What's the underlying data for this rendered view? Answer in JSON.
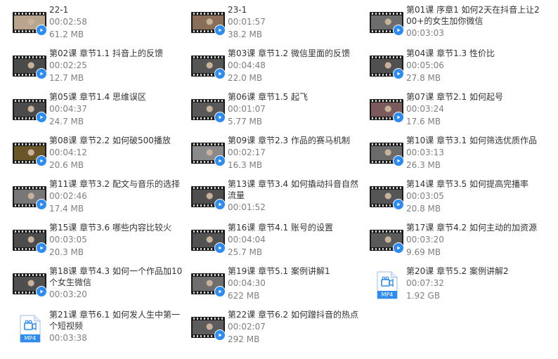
{
  "files": [
    {
      "name": "22-1",
      "duration": "00:02:58",
      "size": "61.2 MB",
      "type": "video",
      "frame": "#b9a58e"
    },
    {
      "name": "23-1",
      "duration": "00:01:57",
      "size": "38.2 MB",
      "type": "video",
      "frame": "#8a6e57"
    },
    {
      "name": "第01课 序章1 如何2天在抖音上让200+的女生加你微信",
      "duration": "00:03:03",
      "size": "",
      "type": "video",
      "frame": "#6d6d6d"
    },
    {
      "name": "第02课 章节1.1 抖音上的反馈",
      "duration": "00:02:25",
      "size": "12.7 MB",
      "type": "video",
      "frame": "#4a4a4a"
    },
    {
      "name": "第03课 章节1.2 微信里面的反馈",
      "duration": "00:04:48",
      "size": "22.0 MB",
      "type": "video",
      "frame": "#555555"
    },
    {
      "name": "第04课 章节1.3 性价比",
      "duration": "00:05:06",
      "size": "27.8 MB",
      "type": "video",
      "frame": "#505050"
    },
    {
      "name": "第05课 章节1.4 思维误区",
      "duration": "00:04:37",
      "size": "24.7 MB",
      "type": "video",
      "frame": "#4b4b4b"
    },
    {
      "name": "第06课 章节1.5 起飞",
      "duration": "00:01:07",
      "size": "5.77 MB",
      "type": "video",
      "frame": "#585858"
    },
    {
      "name": "第07课 章节2.1 如何起号",
      "duration": "00:03:24",
      "size": "17.6 MB",
      "type": "video",
      "frame": "#7a5a5a"
    },
    {
      "name": "第08课 章节2.2 如何破500播放",
      "duration": "00:04:12",
      "size": "20.6 MB",
      "type": "video",
      "frame": "#6a5528"
    },
    {
      "name": "第09课 章节2.3 作品的赛马机制",
      "duration": "00:02:17",
      "size": "16.3 MB",
      "type": "video",
      "frame": "#8a8a8a"
    },
    {
      "name": "第10课 章节3.1 如何筛选优质作品",
      "duration": "00:03:13",
      "size": "26.3 MB",
      "type": "video",
      "frame": "#6b6b6b"
    },
    {
      "name": "第11课 章节3.2 配文与音乐的选择",
      "duration": "00:02:46",
      "size": "17.4 MB",
      "type": "video",
      "frame": "#777777"
    },
    {
      "name": "第13课 章节3.4 如何撬动抖音自然流量",
      "duration": "00:01:52",
      "size": "",
      "type": "video",
      "frame": "#4e4e4e"
    },
    {
      "name": "第14课 章节3.5 如何提高完播率",
      "duration": "00:03:05",
      "size": "20.8 MB",
      "type": "video",
      "frame": "#555555"
    },
    {
      "name": "第15课 章节3.6 哪些内容比较火",
      "duration": "00:03:05",
      "size": "20.3 MB",
      "type": "video",
      "frame": "#4c4c4c"
    },
    {
      "name": "第16课 章节4.1 账号的设置",
      "duration": "00:04:04",
      "size": "25.7 MB",
      "type": "video",
      "frame": "#525252"
    },
    {
      "name": "第17课 章节4.2 如何主动的加资源",
      "duration": "00:03:20",
      "size": "9.69 MB",
      "type": "video",
      "frame": "#5a5a5a"
    },
    {
      "name": "第18课 章节4.3 如何一个作品加10个女生微信",
      "duration": "00:03:20",
      "size": "",
      "type": "video",
      "frame": "#4f4f4f"
    },
    {
      "name": "第19课 章节5.1 案例讲解1",
      "duration": "00:04:30",
      "size": "622 MB",
      "type": "video",
      "frame": "#6e6e6e"
    },
    {
      "name": "第20课 章节5.2 案例讲解2",
      "duration": "00:07:32",
      "size": "1.92 GB",
      "type": "mp4"
    },
    {
      "name": "第21课 章节6.1 如何发人生中第一个短视频",
      "duration": "00:03:38",
      "size": "",
      "type": "mp4"
    },
    {
      "name": "第22课 章节6.2 如何蹭抖音的热点",
      "duration": "00:02:07",
      "size": "292 MB",
      "type": "video",
      "frame": "#5c5c5c"
    }
  ],
  "mp4_label": "MP4",
  "colors": {
    "badge": "#2e8cf0",
    "mp4": "#2e8cf0",
    "name": "#333333",
    "meta": "#7f7f7f"
  }
}
